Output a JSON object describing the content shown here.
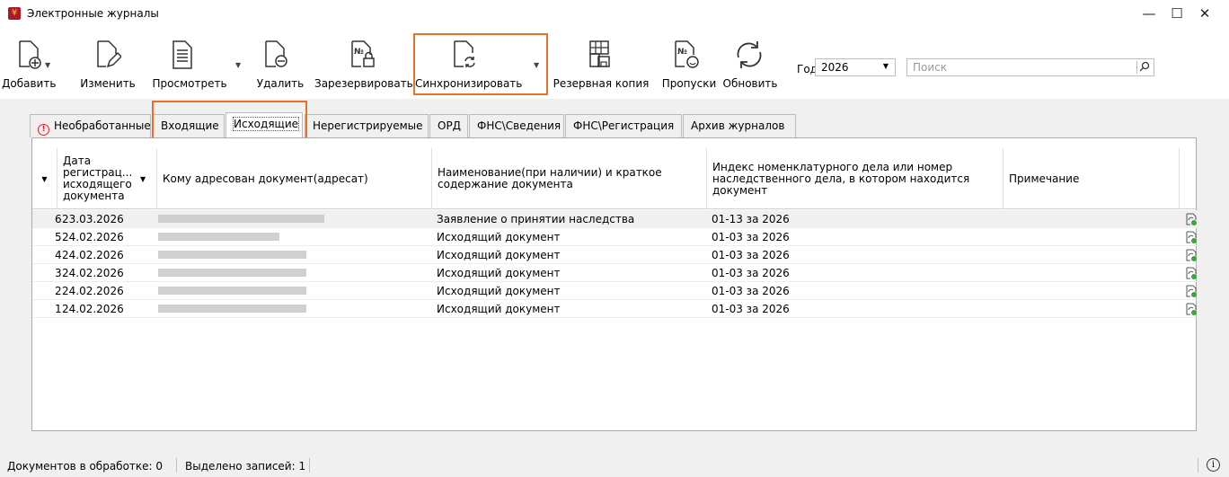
{
  "window": {
    "title": "Электронные журналы",
    "min_glyph": "—",
    "max_glyph": "☐",
    "close_glyph": "✕"
  },
  "toolbar": {
    "add": "Добавить",
    "edit": "Изменить",
    "view": "Просмотреть",
    "delete": "Удалить",
    "reserve": "Зарезервировать",
    "sync": "Синхронизировать",
    "backup": "Резервная копия",
    "skips": "Пропуски",
    "refresh": "Обновить",
    "year_label": "Год",
    "year_value": "2026",
    "search_placeholder": "Поиск"
  },
  "tabs": [
    "Необработанные",
    "Входящие",
    "Исходящие",
    "Нерегистрируемые",
    "ОРД",
    "ФНС\\Сведения",
    "ФНС\\Регистрация",
    "Архив журналов"
  ],
  "active_tab": "Исходящие",
  "columns": {
    "date": "Дата регистрац... исходящего документа",
    "recipient": "Кому адресован документ(адресат)",
    "name": "Наименование(при наличии) и краткое содержание документа",
    "index": "Индекс номенклатурного дела или номер наследственного дела, в котором находится документ",
    "note": "Примечание"
  },
  "rows": [
    {
      "num": "6",
      "date": "23.03.2026",
      "name": "Заявление о принятии наследства",
      "index": "01-13 за 2026",
      "note": ""
    },
    {
      "num": "5",
      "date": "24.02.2026",
      "name": "Исходящий документ",
      "index": "01-03 за 2026",
      "note": ""
    },
    {
      "num": "4",
      "date": "24.02.2026",
      "name": "Исходящий документ",
      "index": "01-03 за 2026",
      "note": ""
    },
    {
      "num": "3",
      "date": "24.02.2026",
      "name": "Исходящий документ",
      "index": "01-03 за 2026",
      "note": ""
    },
    {
      "num": "2",
      "date": "24.02.2026",
      "name": "Исходящий документ",
      "index": "01-03 за 2026",
      "note": ""
    },
    {
      "num": "1",
      "date": "24.02.2026",
      "name": "Исходящий документ",
      "index": "01-03 за 2026",
      "note": ""
    }
  ],
  "status": {
    "processing": "Документов в обработке: 0",
    "selected": "Выделено записей: 1"
  },
  "colors": {
    "highlight": "#e8702a",
    "warning": "#e02424",
    "sync_green": "#3aa635"
  }
}
